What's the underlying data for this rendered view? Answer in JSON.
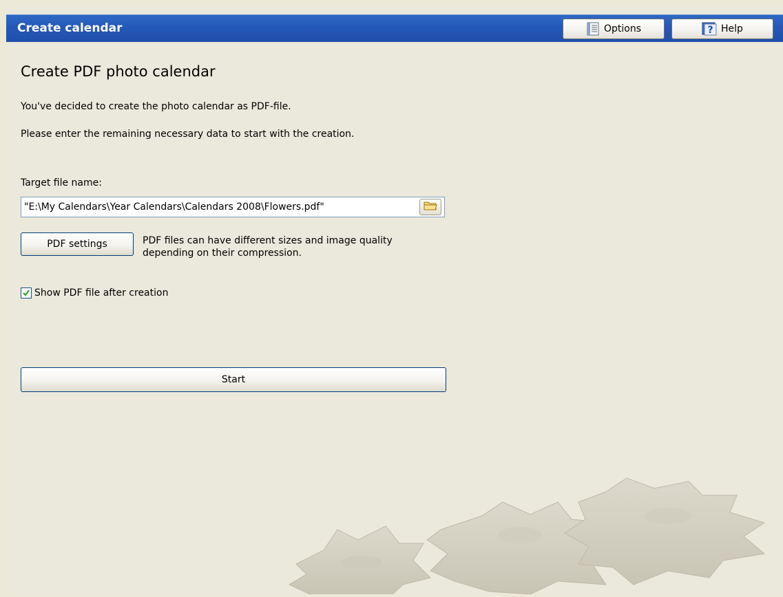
{
  "header": {
    "title": "Create calendar",
    "options_label": "Options",
    "help_label": "Help",
    "brand_color": "#2458b8"
  },
  "main": {
    "title": "Create PDF photo calendar",
    "intro_line1": "You've decided to create the photo calendar as PDF-file.",
    "intro_line2": "Please enter the remaining necessary data to start with the creation.",
    "target_label": "Target file name:",
    "target_value": "\"E:\\My Calendars\\Year Calendars\\Calendars 2008\\Flowers.pdf\"",
    "pdf_settings_label": "PDF settings",
    "pdf_desc_line1": "PDF files can have different sizes and image quality",
    "pdf_desc_line2": "depending on their compression.",
    "show_pdf_label": "Show PDF file after creation",
    "show_pdf_checked": true,
    "start_label": "Start"
  },
  "icons": {
    "options": "list-icon",
    "help": "help-icon",
    "browse": "folder-icon",
    "check": "checkmark-icon",
    "decoration": "gears-decoration"
  }
}
